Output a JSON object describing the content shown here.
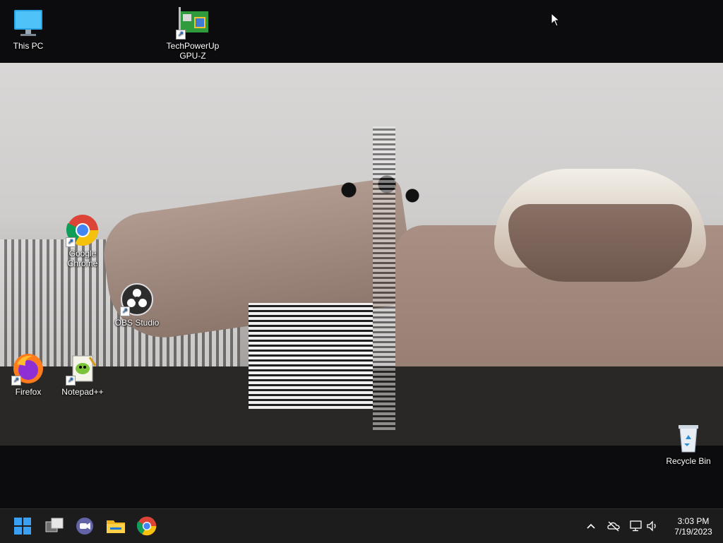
{
  "desktop": {
    "icons": [
      {
        "label": "This PC",
        "icon": "this-pc-icon"
      },
      {
        "label": "TechPowerUp\nGPU-Z",
        "icon": "gpu-z-icon"
      },
      {
        "label": "Google\nChrome",
        "icon": "chrome-icon"
      },
      {
        "label": "OBS Studio",
        "icon": "obs-icon"
      },
      {
        "label": "Firefox",
        "icon": "firefox-icon"
      },
      {
        "label": "Notepad++",
        "icon": "notepad-plus-plus-icon"
      },
      {
        "label": "Recycle Bin",
        "icon": "recycle-bin-icon"
      }
    ]
  },
  "taskbar": {
    "buttons": [
      "start-icon",
      "task-view-icon",
      "teams-chat-icon",
      "file-explorer-icon",
      "chrome-icon"
    ],
    "tray": {
      "icons": [
        "chevron-up-icon",
        "onedrive-offline-icon",
        "network-icon",
        "volume-icon"
      ],
      "time": "3:03 PM",
      "date": "7/19/2023"
    }
  },
  "colors": {
    "taskbar_bg": "#1c1c1c",
    "desktop_bg": "#0c0c0e"
  }
}
